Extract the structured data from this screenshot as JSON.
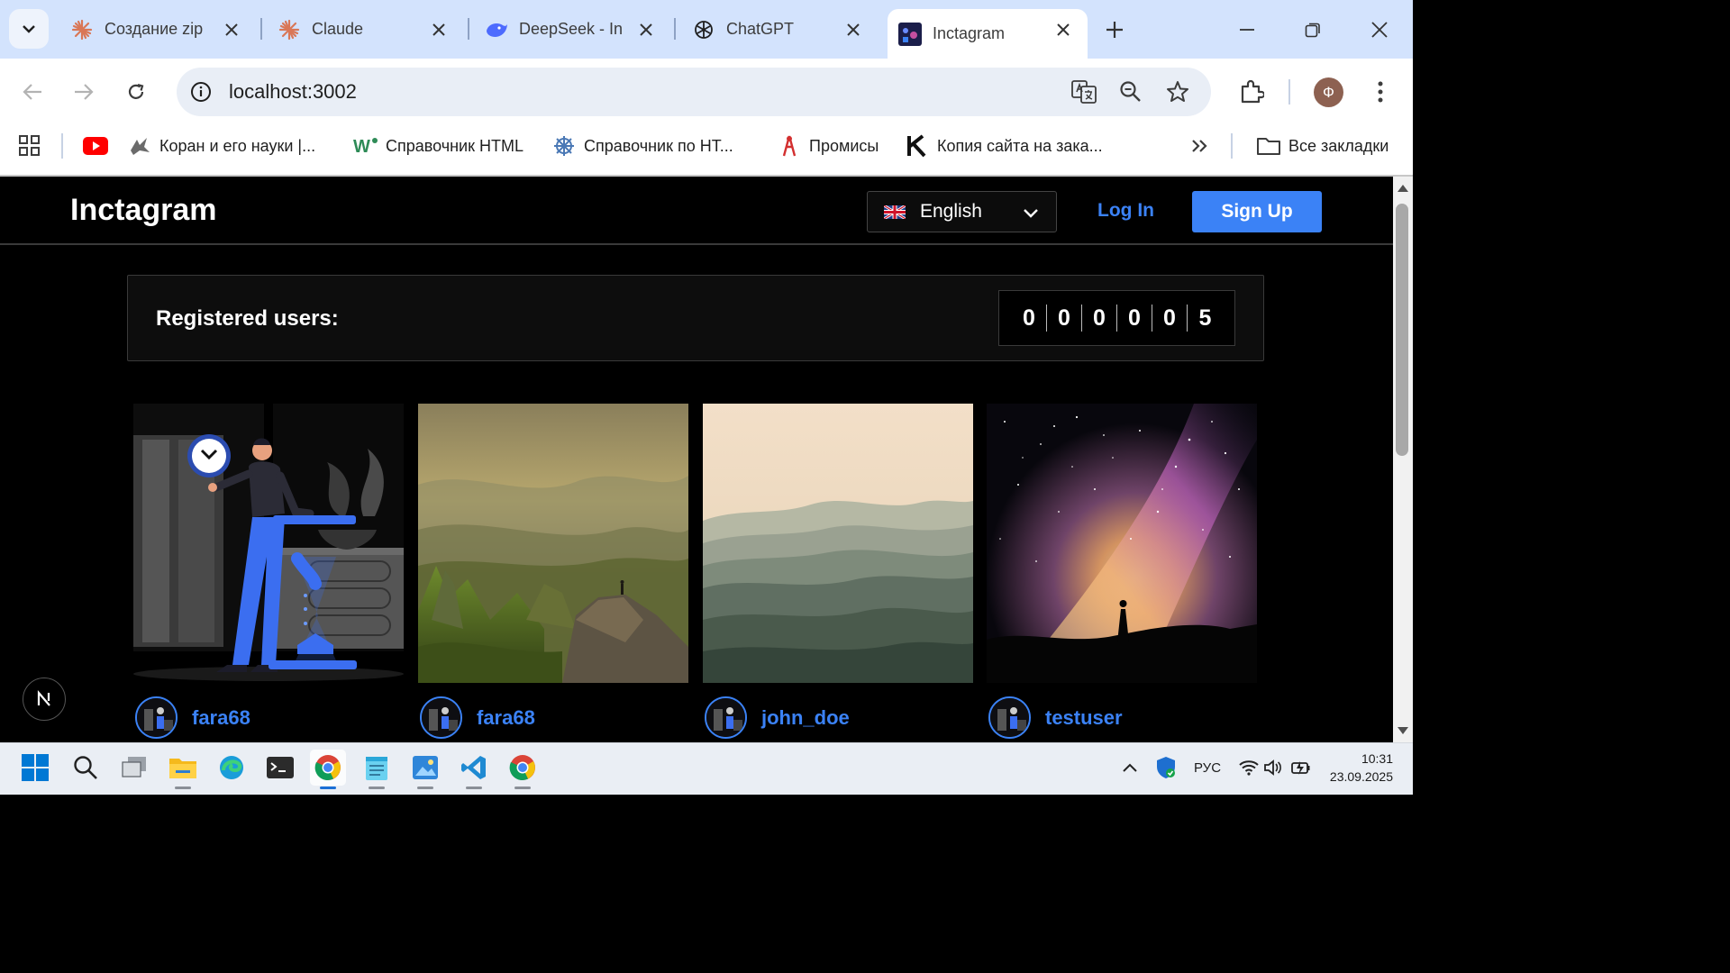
{
  "browser": {
    "tabs": [
      {
        "title": "Создание zip",
        "icon": "claude-icon"
      },
      {
        "title": "Claude",
        "icon": "claude-icon"
      },
      {
        "title": "DeepSeek - In",
        "icon": "deepseek-icon"
      },
      {
        "title": "ChatGPT",
        "icon": "chatgpt-icon"
      },
      {
        "title": "Inctagram",
        "icon": "inctagram-favicon",
        "active": true
      }
    ],
    "url": "localhost:3002",
    "profile_initial": "Ф",
    "bookmarks": [
      {
        "label": "",
        "icon": "youtube-icon"
      },
      {
        "label": "Коран и его науки |...",
        "icon": "quran-icon"
      },
      {
        "label": "Справочник HTML",
        "icon": "w3-icon"
      },
      {
        "label": "Справочник по НТ...",
        "icon": "html-ref-icon"
      },
      {
        "label": "Промисы",
        "icon": "promises-icon"
      },
      {
        "label": "Копия сайта на зака...",
        "icon": "k-icon"
      }
    ],
    "all_bookmarks_label": "Все закладки"
  },
  "site": {
    "brand": "Inctagram",
    "language": "English",
    "login_label": "Log In",
    "signup_label": "Sign Up",
    "registered_label": "Registered users:",
    "registered_digits": [
      "0",
      "0",
      "0",
      "0",
      "0",
      "5"
    ],
    "posts": [
      {
        "username": "fara68",
        "image": "illustration-man-hourglass"
      },
      {
        "username": "fara68",
        "image": "mountain-hiker"
      },
      {
        "username": "john_doe",
        "image": "misty-mountains"
      },
      {
        "username": "testuser",
        "image": "milky-way-silhouette"
      }
    ],
    "accent_color": "#3b82f6"
  },
  "taskbar": {
    "language": "РУС",
    "time": "10:31",
    "date": "23.09.2025"
  }
}
